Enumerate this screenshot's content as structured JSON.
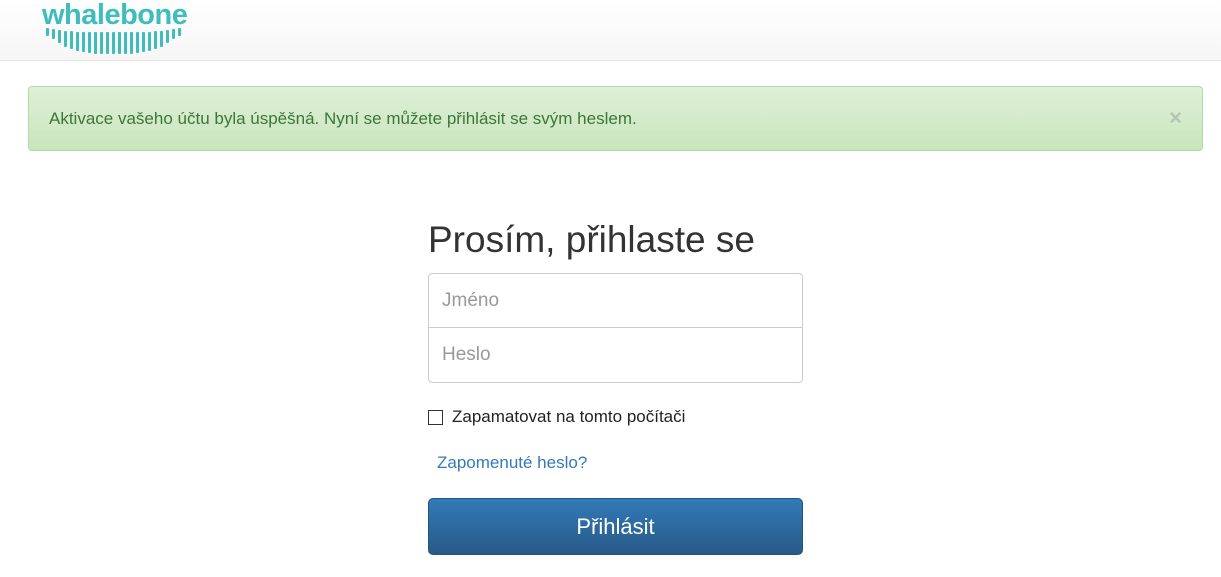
{
  "header": {
    "logo_text": "whalebone",
    "logo_color": "#3fbdbd"
  },
  "alert": {
    "message": "Aktivace vašeho účtu byla úspěšná. Nyní se můžete přihlásit se svým heslem.",
    "close_symbol": "×",
    "type": "success"
  },
  "login": {
    "title": "Prosím, přihlaste se",
    "username_placeholder": "Jméno",
    "password_placeholder": "Heslo",
    "remember_label": "Zapamatovat na tomto počítači",
    "remember_checked": false,
    "forgot_link": "Zapomenuté heslo?",
    "submit_label": "Přihlásit"
  },
  "colors": {
    "accent": "#337ab7",
    "success_text": "#3c763d",
    "success_bg": "#dff0d8"
  }
}
